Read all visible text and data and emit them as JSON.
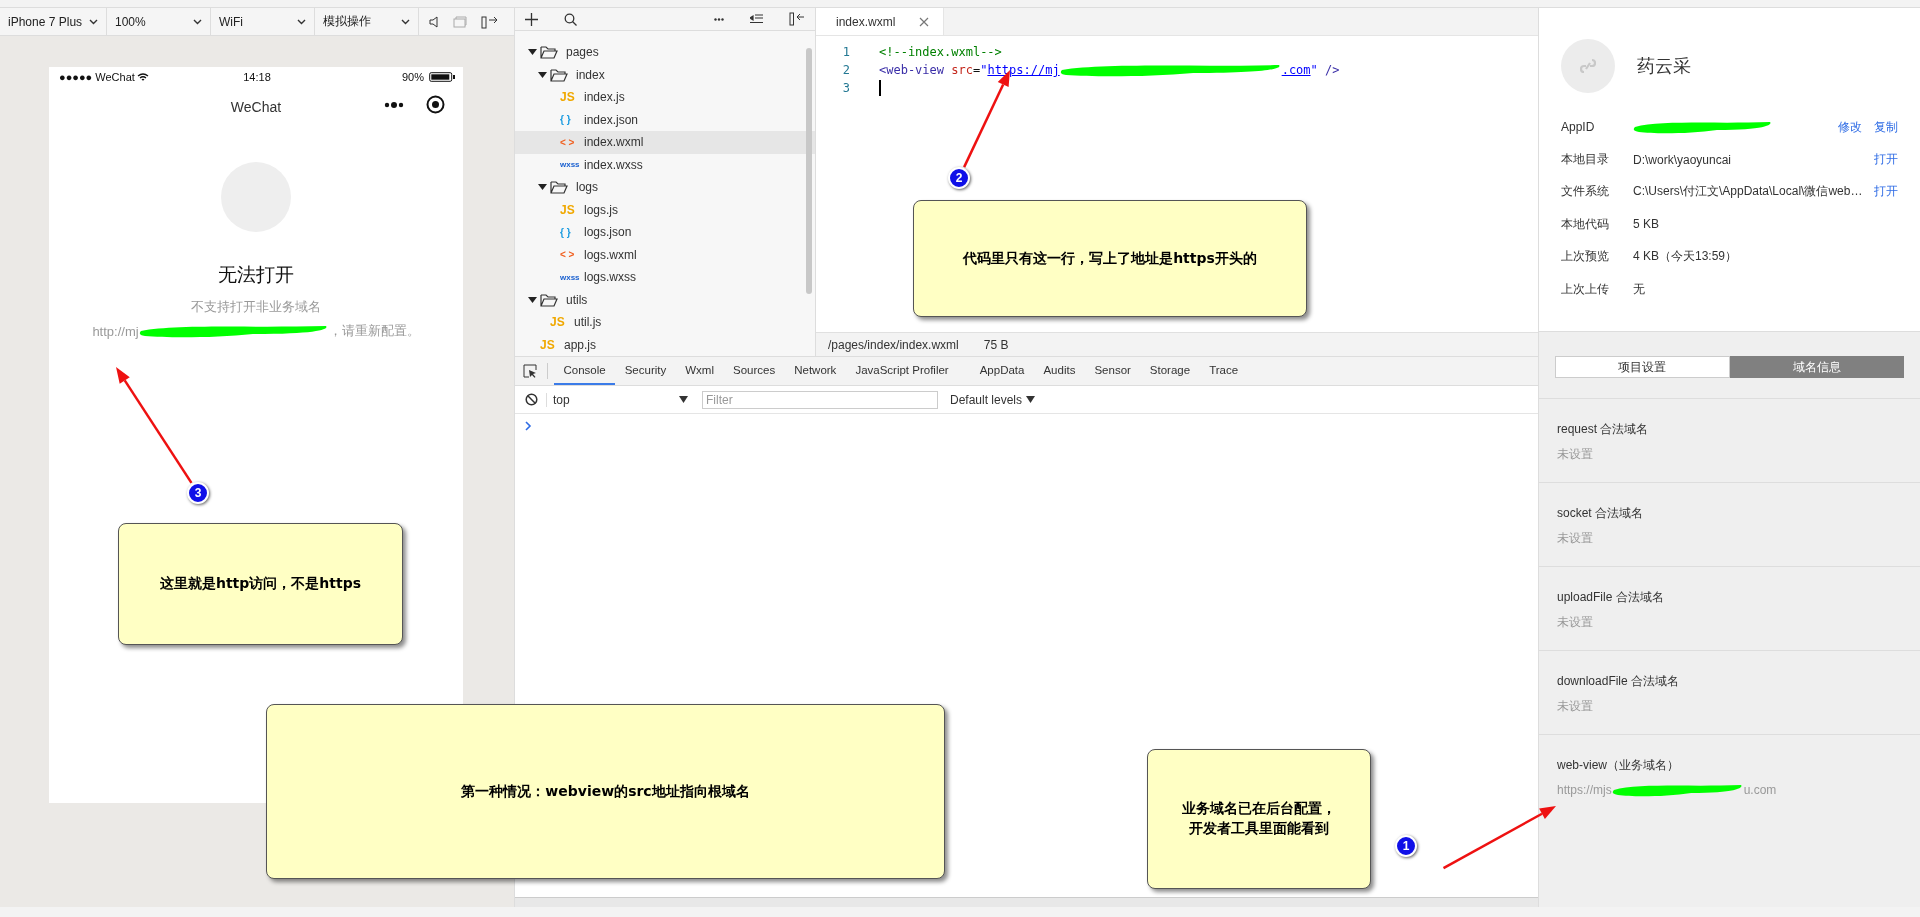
{
  "toolbar": {
    "selects": [
      {
        "value": "iPhone 7 Plus"
      },
      {
        "value": "100%"
      },
      {
        "value": "WiFi"
      },
      {
        "value": "模拟操作"
      }
    ]
  },
  "simulator": {
    "status_bar": {
      "carrier": "●●●●● WeChat",
      "time": "14:18",
      "battery": "90%"
    },
    "nav_title": "WeChat",
    "error_title": "无法打开",
    "error_message": "不支持打开非业务域名",
    "url_start": "http://mj",
    "url_end": "，请重新配置。"
  },
  "file_tree": [
    {
      "name": "pages",
      "kind": "folder",
      "expanded": true,
      "selected": false,
      "children": [
        {
          "name": "index",
          "kind": "folder",
          "expanded": true,
          "selected": false,
          "children": [
            {
              "name": "index.js",
              "kind": "js",
              "icon": "JS",
              "selected": false
            },
            {
              "name": "index.json",
              "kind": "json",
              "icon": "{ }",
              "selected": false
            },
            {
              "name": "index.wxml",
              "kind": "wxml",
              "icon": "< >",
              "selected": true
            },
            {
              "name": "index.wxss",
              "kind": "wxss",
              "icon": "wxss",
              "selected": false
            }
          ]
        },
        {
          "name": "logs",
          "kind": "folder",
          "expanded": true,
          "selected": false,
          "children": [
            {
              "name": "logs.js",
              "kind": "js",
              "icon": "JS",
              "selected": false
            },
            {
              "name": "logs.json",
              "kind": "json",
              "icon": "{ }",
              "selected": false
            },
            {
              "name": "logs.wxml",
              "kind": "wxml",
              "icon": "< >",
              "selected": false
            },
            {
              "name": "logs.wxss",
              "kind": "wxss",
              "icon": "wxss",
              "selected": false
            }
          ]
        }
      ]
    },
    {
      "name": "utils",
      "kind": "folder",
      "expanded": true,
      "selected": false,
      "children": [
        {
          "name": "util.js",
          "kind": "js",
          "icon": "JS",
          "selected": false
        }
      ]
    },
    {
      "name": "app.js",
      "kind": "js",
      "icon": "JS",
      "selected": false
    }
  ],
  "editor": {
    "tab": "index.wxml",
    "lines": [
      {
        "number": "1",
        "cursor": false,
        "tokens": [
          {
            "kind": "comment",
            "text": "<!--index.wxml-->"
          }
        ]
      },
      {
        "number": "2",
        "cursor": false,
        "tokens": [
          {
            "kind": "tag",
            "text": "<web-view "
          },
          {
            "kind": "attr",
            "text": "src"
          },
          {
            "kind": "punct",
            "text": "="
          },
          {
            "kind": "string",
            "text": "\""
          },
          {
            "kind": "link",
            "text": "https://mj"
          },
          {
            "kind": "redacted"
          },
          {
            "kind": "link",
            "text": ".com"
          },
          {
            "kind": "string",
            "text": "\""
          },
          {
            "kind": "tag",
            "text": " />"
          }
        ]
      },
      {
        "number": "3",
        "cursor": true
      }
    ],
    "status": {
      "path": "/pages/index/index.wxml",
      "size": "75 B"
    }
  },
  "devtools": {
    "tabs": [
      {
        "label": "Console",
        "selected": true
      },
      {
        "label": "Security",
        "selected": false
      },
      {
        "label": "Wxml",
        "selected": false
      },
      {
        "label": "Sources",
        "selected": false
      },
      {
        "label": "Network",
        "selected": false
      },
      {
        "label": "JavaScript Profiler",
        "selected": false
      },
      {
        "label": "AppData",
        "selected": false
      },
      {
        "label": "Audits",
        "selected": false
      },
      {
        "label": "Sensor",
        "selected": false
      },
      {
        "label": "Storage",
        "selected": false
      },
      {
        "label": "Trace",
        "selected": false
      }
    ],
    "context": "top",
    "filter_placeholder": "Filter",
    "levels": "Default levels"
  },
  "project": {
    "name": "药云采",
    "rows": [
      {
        "label": "AppID",
        "redacted": true,
        "actions": [
          "修改",
          "复制"
        ]
      },
      {
        "label": "本地目录",
        "redacted": false,
        "value": "D:\\work\\yaoyuncai",
        "actions": [
          "打开"
        ]
      },
      {
        "label": "文件系统",
        "redacted": false,
        "value": "C:\\Users\\付江文\\AppData\\Local\\微信web…",
        "actions": [
          "打开"
        ]
      },
      {
        "label": "本地代码",
        "redacted": false,
        "value": "5 KB"
      },
      {
        "label": "上次预览",
        "redacted": false,
        "value": "4 KB（今天13:59）"
      },
      {
        "label": "上次上传",
        "redacted": false,
        "value": "无"
      }
    ],
    "segments": [
      {
        "label": "项目设置",
        "selected": false
      },
      {
        "label": "域名信息",
        "selected": true
      }
    ],
    "domains": [
      {
        "title": "request 合法域名",
        "kind": "unset",
        "value": "未设置"
      },
      {
        "title": "socket 合法域名",
        "kind": "unset",
        "value": "未设置"
      },
      {
        "title": "uploadFile 合法域名",
        "kind": "unset",
        "value": "未设置"
      },
      {
        "title": "downloadFile 合法域名",
        "kind": "unset",
        "value": "未设置"
      },
      {
        "title": "web-view（业务域名）",
        "kind": "url",
        "value_start": "https://mjs",
        "value_end": "u.com"
      }
    ]
  },
  "callouts": [
    {
      "text": "代码里只有这一行，写上了地址是https开头的"
    },
    {
      "text": "这里就是http访问，不是https"
    },
    {
      "text": "第一种情况：webview的src地址指向根域名"
    },
    {
      "text": "业务域名已在后台配置，开发者工具里面能看到"
    }
  ],
  "badges": [
    "2",
    "3",
    "1"
  ]
}
